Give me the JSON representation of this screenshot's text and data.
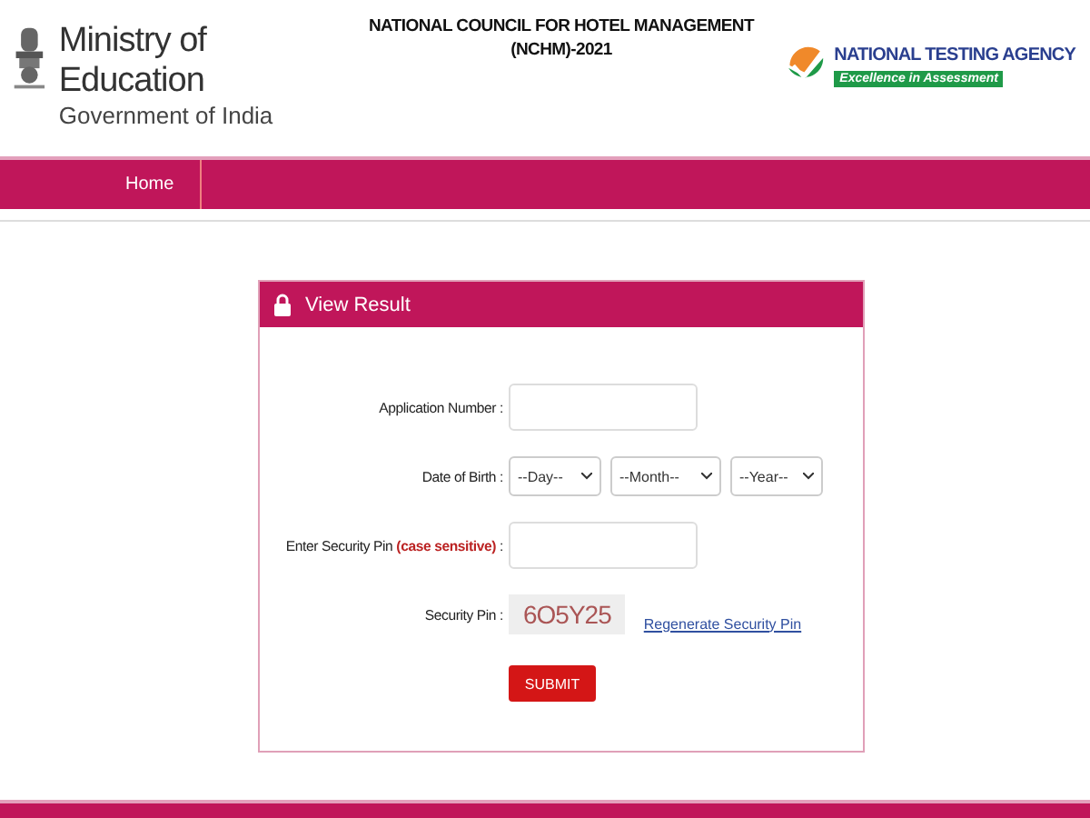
{
  "header": {
    "ministry": "Ministry of Education",
    "government": "Government of India",
    "title_line_1": "NATIONAL COUNCIL FOR HOTEL MANAGEMENT",
    "title_line_2": "(NCHM)-2021",
    "agency": "NATIONAL TESTING AGENCY",
    "agency_tagline": "Excellence in Assessment"
  },
  "nav": [
    {
      "label": "Home"
    }
  ],
  "panel": {
    "title": "View Result",
    "application_label": "Application Number :",
    "dob_label": "Date of Birth :",
    "dob_selects": [
      "--Day--",
      "--Month--",
      "--Year--"
    ],
    "pin_label": "Enter Security Pin ",
    "pin_label_note": "(case sensitive)",
    "pin_label_end": " :",
    "captcha_label": "Security Pin :",
    "captcha": "6O5Y25",
    "regenerate": "Regenerate Security Pin",
    "submit": "SUBMIT"
  }
}
